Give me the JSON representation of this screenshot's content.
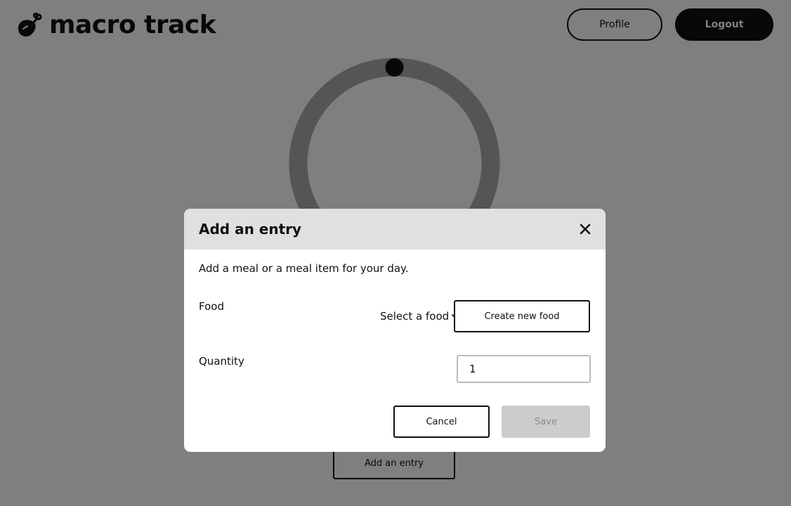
{
  "header": {
    "app_name": "macro track",
    "logo_icon": "chicken-leg-icon",
    "profile_label": "Profile",
    "logout_label": "Logout"
  },
  "background": {
    "add_entry_label": "Add an entry"
  },
  "modal": {
    "title": "Add an entry",
    "description": "Add a meal or a meal item for your day.",
    "food_label": "Food",
    "food_select_value": "Select a food",
    "create_food_label": "Create new food",
    "quantity_label": "Quantity",
    "quantity_value": "1",
    "cancel_label": "Cancel",
    "save_label": "Save",
    "close_icon": "close-icon"
  },
  "colors": {
    "primary": "#111111",
    "overlay": "rgba(0,0,0,0.5)",
    "modal_header_bg": "#e0e0e0",
    "disabled_button_bg": "#cccccc",
    "disabled_button_text": "#8a8a8a"
  }
}
